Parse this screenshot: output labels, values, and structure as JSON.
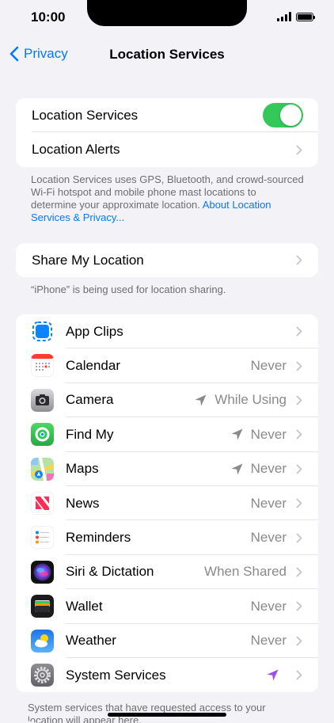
{
  "status": {
    "time": "10:00"
  },
  "nav": {
    "back_label": "Privacy",
    "title": "Location Services"
  },
  "main_group": {
    "location_services_label": "Location Services",
    "location_services_on": true,
    "location_alerts_label": "Location Alerts"
  },
  "info_text": {
    "body": "Location Services uses GPS, Bluetooth, and crowd-sourced Wi-Fi hotspot and mobile phone mast locations to determine your approximate location.",
    "link": "About Location Services & Privacy..."
  },
  "share": {
    "label": "Share My Location",
    "note": "“iPhone” is being used for location sharing."
  },
  "apps": [
    {
      "name": "App Clips",
      "value": "",
      "icon": "app-clips-icon",
      "arrow": ""
    },
    {
      "name": "Calendar",
      "value": "Never",
      "icon": "calendar-icon",
      "arrow": ""
    },
    {
      "name": "Camera",
      "value": "While Using",
      "icon": "camera-icon",
      "arrow": "gray"
    },
    {
      "name": "Find My",
      "value": "Never",
      "icon": "find-my-icon",
      "arrow": "gray"
    },
    {
      "name": "Maps",
      "value": "Never",
      "icon": "maps-icon",
      "arrow": "gray"
    },
    {
      "name": "News",
      "value": "Never",
      "icon": "news-icon",
      "arrow": ""
    },
    {
      "name": "Reminders",
      "value": "Never",
      "icon": "reminders-icon",
      "arrow": ""
    },
    {
      "name": "Siri & Dictation",
      "value": "When Shared",
      "icon": "siri-icon",
      "arrow": ""
    },
    {
      "name": "Wallet",
      "value": "Never",
      "icon": "wallet-icon",
      "arrow": ""
    },
    {
      "name": "Weather",
      "value": "Never",
      "icon": "weather-icon",
      "arrow": ""
    },
    {
      "name": "System Services",
      "value": "",
      "icon": "system-services-icon",
      "arrow": "purple"
    }
  ],
  "bottom_note": "System services that have requested access to your location will appear here.",
  "colors": {
    "accent": "#007aff",
    "toggle_on": "#34c759",
    "arrow_purple": "#a04cf0",
    "arrow_gray": "#8a8a8e"
  }
}
